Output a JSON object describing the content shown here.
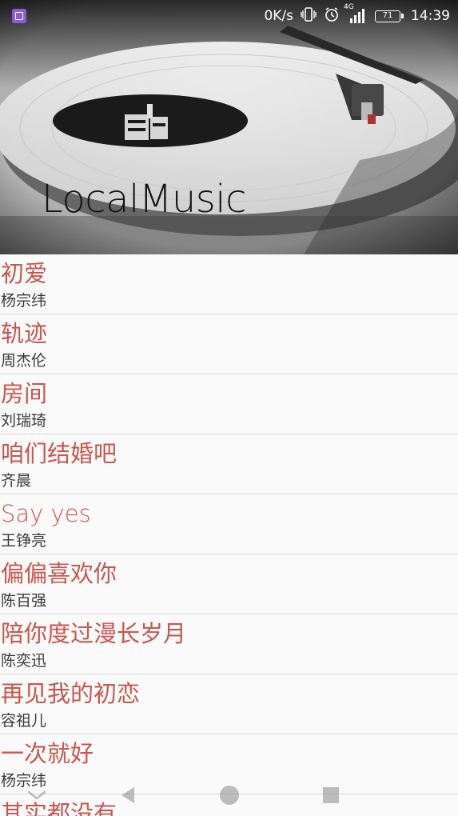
{
  "status_bar": {
    "net_speed": "0K/s",
    "signal_type": "4G",
    "battery": "71",
    "time": "14:39",
    "icons": [
      "app-notification-icon",
      "vibrate-icon",
      "alarm-icon",
      "signal-icon",
      "battery-icon"
    ]
  },
  "header": {
    "title": "LocalMusic",
    "background": "turntable-photo"
  },
  "colors": {
    "song_title": "#c8574f",
    "artist": "#3a3a3a",
    "divider": "#d8d8d8",
    "background": "#fafafa"
  },
  "songs": [
    {
      "title": "初爱",
      "artist": "杨宗纬"
    },
    {
      "title": "轨迹",
      "artist": "周杰伦"
    },
    {
      "title": "房间",
      "artist": "刘瑞琦"
    },
    {
      "title": "咱们结婚吧",
      "artist": "齐晨"
    },
    {
      "title": "Say yes",
      "artist": "王铮亮"
    },
    {
      "title": "偏偏喜欢你",
      "artist": "陈百强"
    },
    {
      "title": "陪你度过漫长岁月",
      "artist": "陈奕迅"
    },
    {
      "title": "再见我的初恋",
      "artist": "容祖儿"
    },
    {
      "title": "一次就好",
      "artist": "杨宗纬"
    },
    {
      "title": "其实都没有",
      "artist": ""
    }
  ],
  "nav_bar": {
    "buttons": [
      "hide-nav-icon",
      "back-icon",
      "home-icon",
      "recent-apps-icon"
    ]
  }
}
